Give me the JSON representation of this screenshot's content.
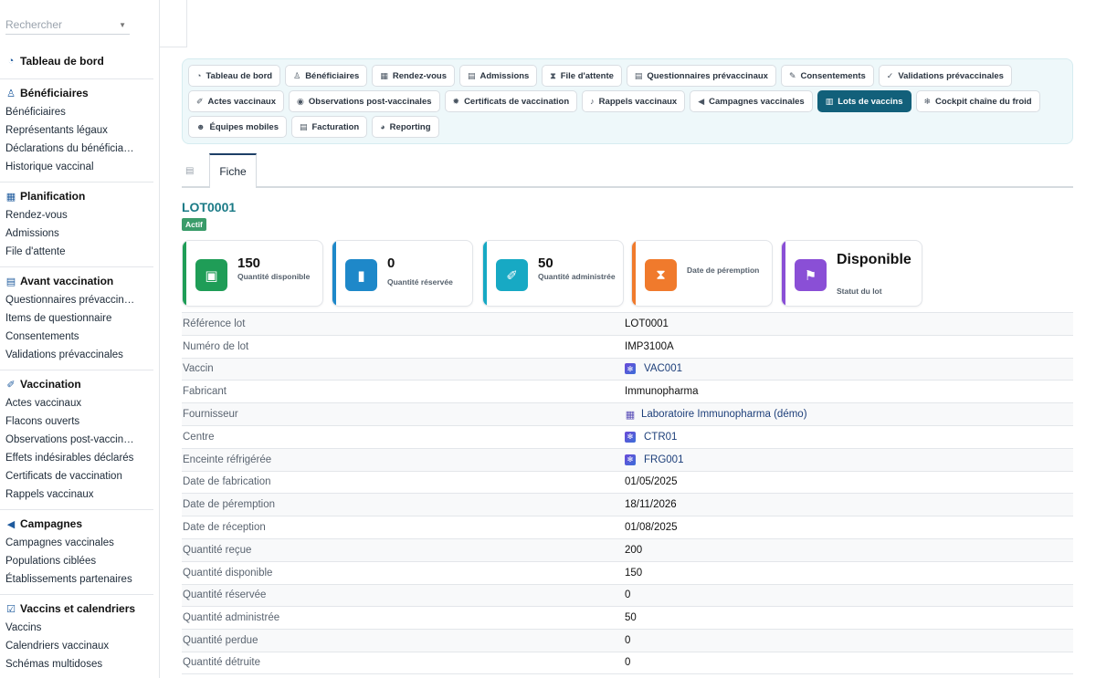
{
  "search": {
    "placeholder": "Rechercher"
  },
  "sidebar": {
    "dashboard": "Tableau de bord",
    "sections": [
      {
        "title": "Bénéficiaires",
        "icon": "person-tree-icon",
        "items": [
          "Bénéficiaires",
          "Représentants légaux",
          "Déclarations du bénéficia…",
          "Historique vaccinal"
        ]
      },
      {
        "title": "Planification",
        "icon": "calendar-icon",
        "items": [
          "Rendez-vous",
          "Admissions",
          "File d'attente"
        ]
      },
      {
        "title": "Avant vaccination",
        "icon": "clipboard-icon",
        "items": [
          "Questionnaires prévaccin…",
          "Items de questionnaire",
          "Consentements",
          "Validations prévaccinales"
        ]
      },
      {
        "title": "Vaccination",
        "icon": "syringe-icon",
        "items": [
          "Actes vaccinaux",
          "Flacons ouverts",
          "Observations post-vaccin…",
          "Effets indésirables déclarés",
          "Certificats de vaccination",
          "Rappels vaccinaux"
        ]
      },
      {
        "title": "Campagnes",
        "icon": "megaphone-icon",
        "items": [
          "Campagnes vaccinales",
          "Populations ciblées",
          "Établissements partenaires"
        ]
      },
      {
        "title": "Vaccins et calendriers",
        "icon": "checkbox-icon",
        "items": [
          "Vaccins",
          "Calendriers vaccinaux",
          "Schémas multidoses"
        ]
      }
    ]
  },
  "menu": {
    "rows": [
      [
        {
          "label": "Tableau de bord",
          "icon": "gauge-icon",
          "glyph": "◔"
        },
        {
          "label": "Bénéficiaires",
          "icon": "person-tree-icon",
          "glyph": "♙"
        },
        {
          "label": "Rendez-vous",
          "icon": "calendar-icon",
          "glyph": "▦"
        },
        {
          "label": "Admissions",
          "icon": "clipboard-icon",
          "glyph": "▤"
        },
        {
          "label": "File d'attente",
          "icon": "hourglass-icon",
          "glyph": "⧗"
        },
        {
          "label": "Questionnaires prévaccinaux",
          "icon": "clipboard-list-icon",
          "glyph": "▤"
        },
        {
          "label": "Consentements",
          "icon": "signature-icon",
          "glyph": "✎"
        },
        {
          "label": "Validations prévaccinales",
          "icon": "user-check-icon",
          "glyph": "✓"
        }
      ],
      [
        {
          "label": "Actes vaccinaux",
          "icon": "syringe-icon",
          "glyph": "✐"
        },
        {
          "label": "Observations post-vaccinales",
          "icon": "eye-icon",
          "glyph": "◉"
        },
        {
          "label": "Certificats de vaccination",
          "icon": "certificate-icon",
          "glyph": "✹"
        },
        {
          "label": "Rappels vaccinaux",
          "icon": "bell-icon",
          "glyph": "♪"
        },
        {
          "label": "Campagnes vaccinales",
          "icon": "megaphone-icon",
          "glyph": "◀"
        },
        {
          "label": "Lots de vaccins",
          "icon": "barcode-icon",
          "glyph": "▥",
          "active": true
        },
        {
          "label": "Cockpit chaîne du froid",
          "icon": "snowflake-icon",
          "glyph": "❄"
        }
      ],
      [
        {
          "label": "Équipes mobiles",
          "icon": "users-icon",
          "glyph": "☻"
        },
        {
          "label": "Facturation",
          "icon": "invoice-icon",
          "glyph": "▤"
        },
        {
          "label": "Reporting",
          "icon": "pie-chart-icon",
          "glyph": "◕"
        }
      ]
    ]
  },
  "tabs": {
    "active": "Fiche"
  },
  "record": {
    "title": "LOT0001",
    "status": "Actif"
  },
  "kpis": [
    {
      "value": "150",
      "label": "Quantité disponible",
      "color": "#1f9d57",
      "icon": "boxes-icon",
      "glyph": "▣"
    },
    {
      "value": "0",
      "label": "Quantité réservée",
      "color": "#1e88c9",
      "icon": "bookmark-icon",
      "glyph": "▮"
    },
    {
      "value": "50",
      "label": "Quantité administrée",
      "color": "#17a9c4",
      "icon": "syringe-icon",
      "glyph": "✐"
    },
    {
      "value": "",
      "label": "Date de péremption",
      "color": "#f07a2c",
      "icon": "hourglass-icon",
      "glyph": "⧗"
    },
    {
      "value": "Disponible",
      "label": "Statut du lot",
      "color": "#8a4fd6",
      "icon": "flag-icon",
      "glyph": "⚑"
    }
  ],
  "details": [
    {
      "label": "Référence lot",
      "value": "LOT0001"
    },
    {
      "label": "Numéro de lot",
      "value": "IMP3100A"
    },
    {
      "label": "Vaccin",
      "value": "VAC001",
      "link": true,
      "icon": "record-icon"
    },
    {
      "label": "Fabricant",
      "value": "Immunopharma"
    },
    {
      "label": "Fournisseur",
      "value": "Laboratoire Immunopharma (démo)",
      "link": true,
      "icon": "building-icon"
    },
    {
      "label": "Centre",
      "value": "CTR01",
      "link": true,
      "icon": "record-icon"
    },
    {
      "label": "Enceinte réfrigérée",
      "value": "FRG001",
      "link": true,
      "icon": "record-icon"
    },
    {
      "label": "Date de fabrication",
      "value": "01/05/2025"
    },
    {
      "label": "Date de péremption",
      "value": "18/11/2026"
    },
    {
      "label": "Date de réception",
      "value": "01/08/2025"
    },
    {
      "label": "Quantité reçue",
      "value": "200"
    },
    {
      "label": "Quantité disponible",
      "value": "150"
    },
    {
      "label": "Quantité réservée",
      "value": "0"
    },
    {
      "label": "Quantité administrée",
      "value": "50"
    },
    {
      "label": "Quantité perdue",
      "value": "0"
    },
    {
      "label": "Quantité détruite",
      "value": "0"
    }
  ]
}
